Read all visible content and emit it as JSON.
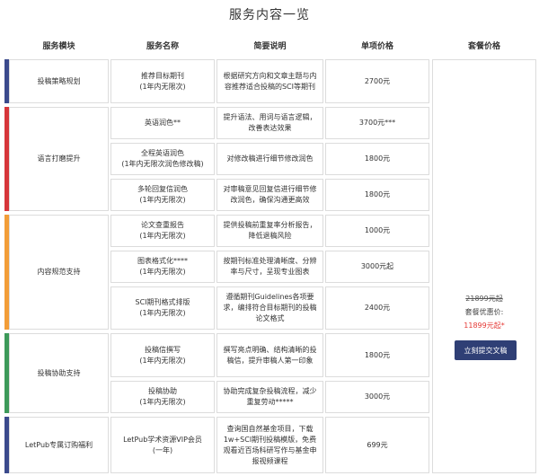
{
  "page_title": "服务内容一览",
  "headers": {
    "module": "服务模块",
    "name": "服务名称",
    "desc": "简要说明",
    "price": "单项价格",
    "package": "套餐价格"
  },
  "modules": {
    "m1": "投稿策略规划",
    "m2": "语言打磨提升",
    "m3": "内容规范支持",
    "m4": "投稿协助支持",
    "m5": "LetPub专属订购福利"
  },
  "rows": {
    "r1": {
      "name_line1": "推荐目标期刊",
      "name_line2": "(1年内无限次)",
      "desc": "根据研究方向和文章主题与内容推荐适合投稿的SCI等期刊",
      "price": "2700元"
    },
    "r2": {
      "name_line1": "英语润色**",
      "name_line2": "",
      "desc": "提升语法、用词与语言逻辑，改善表达效果",
      "price": "3700元***"
    },
    "r3": {
      "name_line1": "全程英语润色",
      "name_line2": "(1年内无限次润色修改稿)",
      "desc": "对修改稿进行细节修改润色",
      "price": "1800元"
    },
    "r4": {
      "name_line1": "多轮回复信润色",
      "name_line2": "(1年内无限次)",
      "desc": "对审稿意见回复信进行细节修改润色，确保沟通更高效",
      "price": "1800元"
    },
    "r5": {
      "name_line1": "论文查重报告",
      "name_line2": "(1年内无限次)",
      "desc": "提供投稿前重复率分析报告，降低退稿风险",
      "price": "1000元"
    },
    "r6": {
      "name_line1": "图表格式化****",
      "name_line2": "(1年内无限次)",
      "desc": "按期刊标准处理清晰度、分辨率与尺寸，呈现专业图表",
      "price": "3000元起"
    },
    "r7": {
      "name_line1": "SCI期刊格式排版",
      "name_line2": "(1年内无限次)",
      "desc": "遵循期刊Guidelines各项要求，编排符合目标期刊的投稿论文格式",
      "price": "2400元"
    },
    "r8": {
      "name_line1": "投稿信撰写",
      "name_line2": "(1年内无限次)",
      "desc": "撰写亮点明确、结构清晰的投稿信，提升审稿人第一印象",
      "price": "1800元"
    },
    "r9": {
      "name_line1": "投稿协助",
      "name_line2": "(1年内无限次)",
      "desc": "协助完成复杂投稿流程，减少重复劳动*****",
      "price": "3000元"
    },
    "r10": {
      "name_line1": "LetPub学术资源VIP会员",
      "name_line2": "(一年)",
      "desc": "查询国自然基金项目，下载1w+SCI期刊投稿模版，免费观看近百场科研写作与基金申报视频课程",
      "price": "699元"
    }
  },
  "package": {
    "original_price": "21899元起",
    "discount_label": "套餐优惠价:",
    "discount_price": "11899元起*",
    "submit_label": "立刻提交文稿"
  },
  "colors": {
    "bar_m1": "#3b4a8c",
    "bar_m2": "#d6363a",
    "bar_m3": "#f29d38",
    "bar_m4": "#3d9a5a",
    "bar_m5": "#3b4a8c",
    "button": "#2f3f75",
    "discount": "#e53935"
  }
}
